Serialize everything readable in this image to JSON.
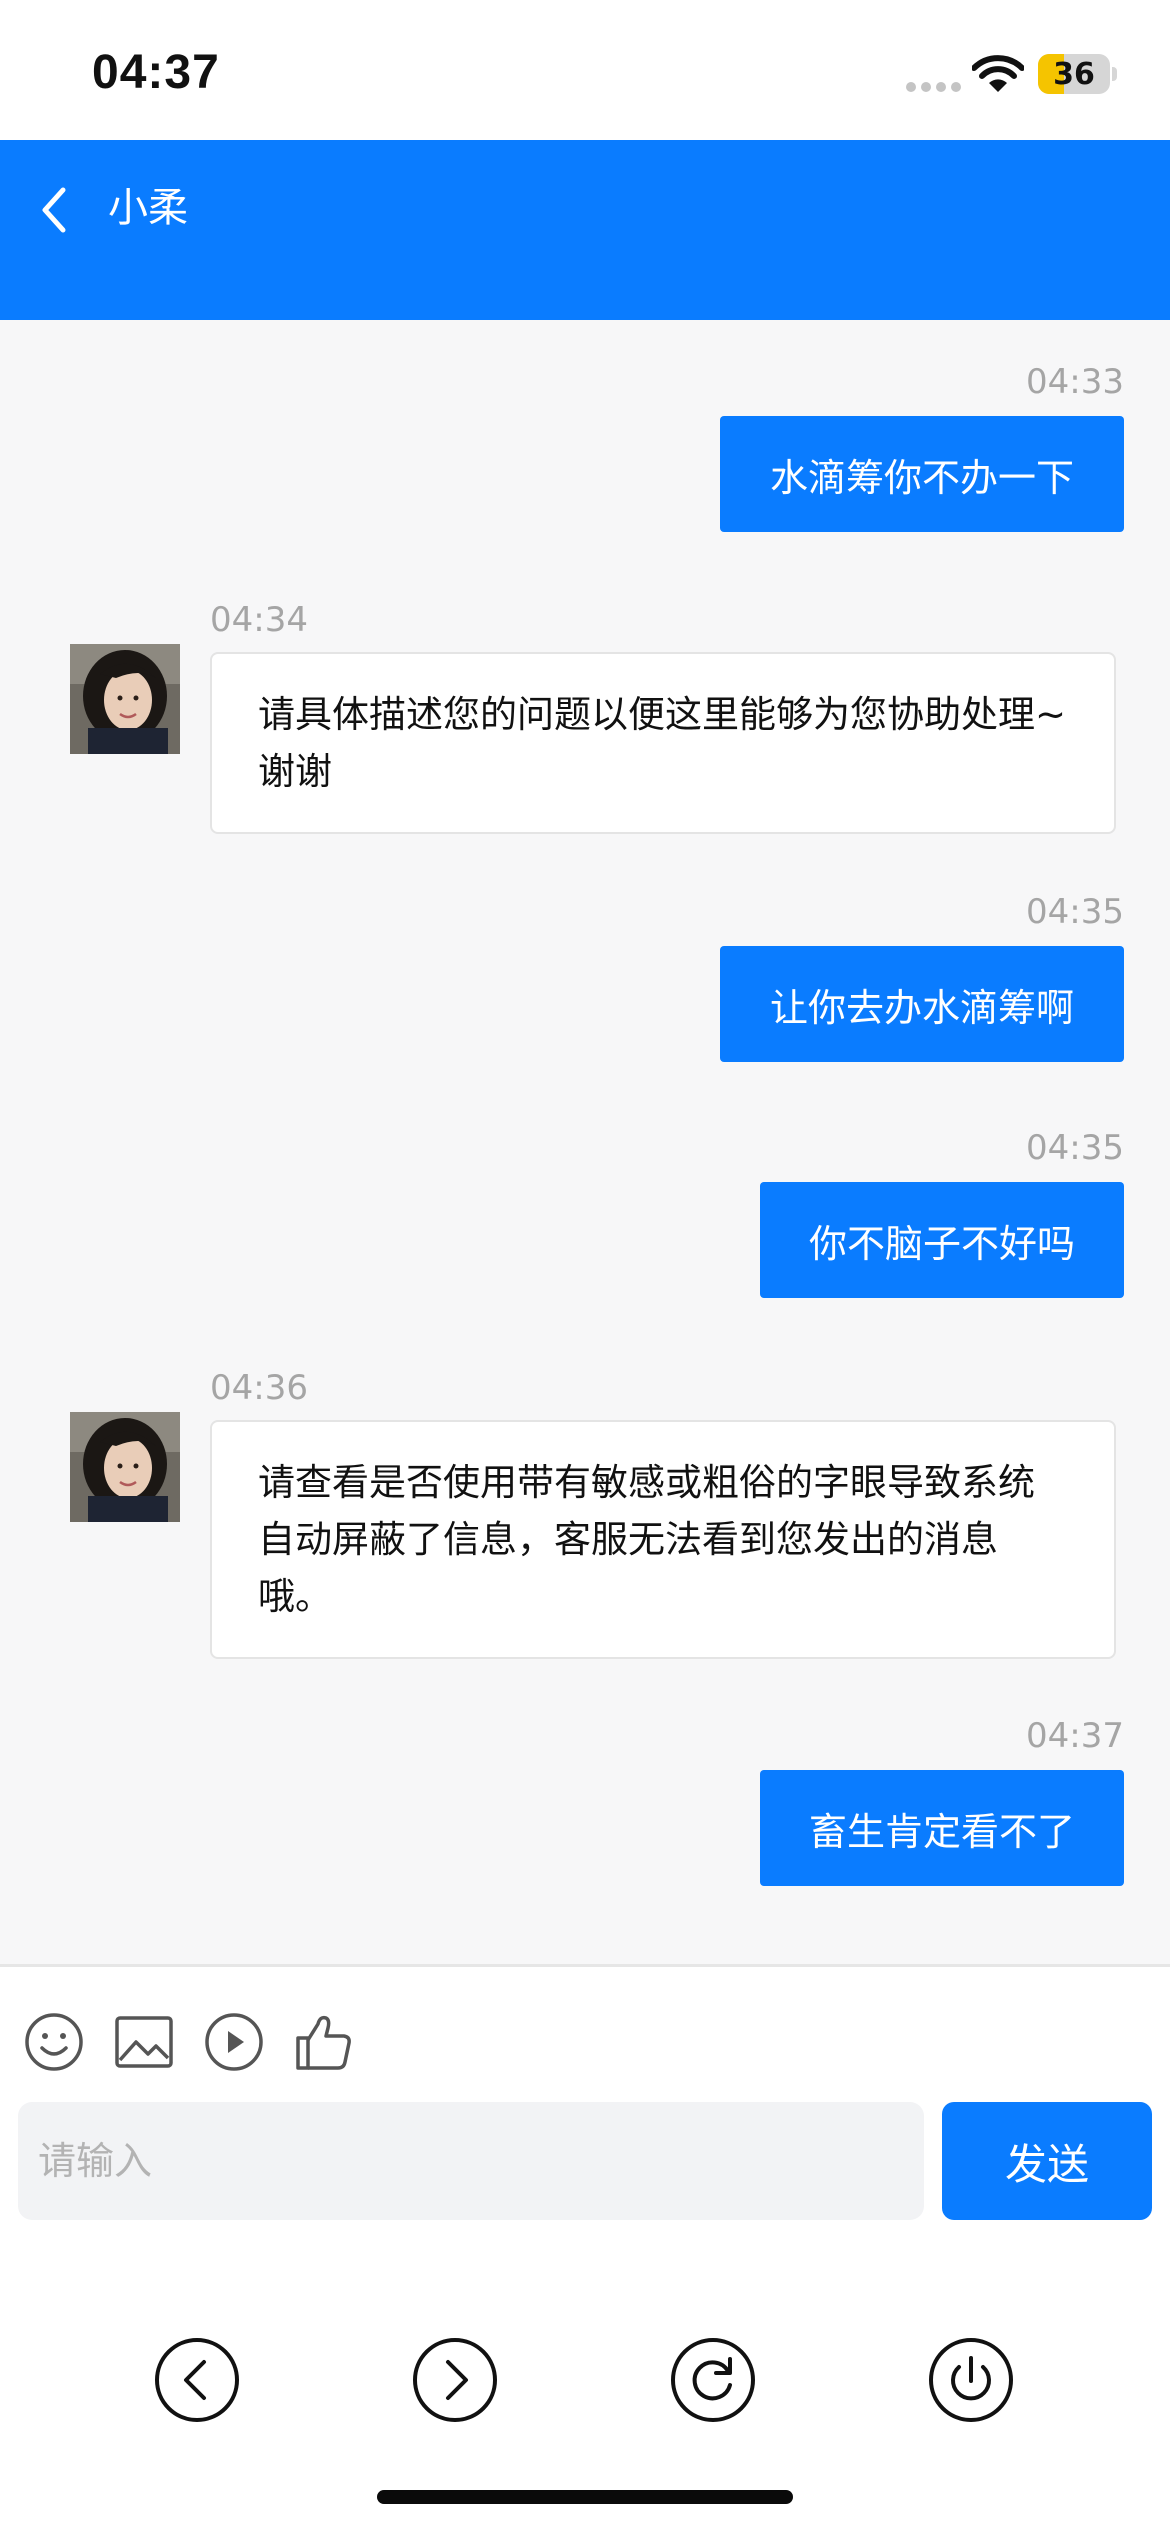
{
  "status_bar": {
    "time": "04:37",
    "battery_level": "36",
    "battery_fraction": 0.36
  },
  "header": {
    "title": "小柔",
    "back_icon": "chevron-left-icon"
  },
  "messages": [
    {
      "direction": "outgoing",
      "time": "04:33",
      "text": "水滴筹你不办一下"
    },
    {
      "direction": "incoming",
      "time": "04:34",
      "text": "请具体描述您的问题以便这里能够为您协助处理~谢谢"
    },
    {
      "direction": "outgoing",
      "time": "04:35",
      "text": "让你去办水滴筹啊"
    },
    {
      "direction": "outgoing",
      "time": "04:35",
      "text": "你不脑子不好吗"
    },
    {
      "direction": "incoming",
      "time": "04:36",
      "text": "请查看是否使用带有敏感或粗俗的字眼导致系统自动屏蔽了信息，客服无法看到您发出的消息哦。"
    },
    {
      "direction": "outgoing",
      "time": "04:37",
      "text": "畜生肯定看不了"
    }
  ],
  "toolbar": {
    "icons": [
      "smiley-icon",
      "image-icon",
      "play-icon",
      "thumbs-up-icon"
    ]
  },
  "input": {
    "placeholder": "请输入",
    "value": "",
    "send_label": "发送"
  },
  "nav": {
    "icons": [
      "back-circle-icon",
      "forward-circle-icon",
      "refresh-icon",
      "power-icon"
    ]
  },
  "colors": {
    "accent": "#0a7cff",
    "chat_background": "#f7f7f8",
    "timestamp": "#a5a5a5"
  }
}
